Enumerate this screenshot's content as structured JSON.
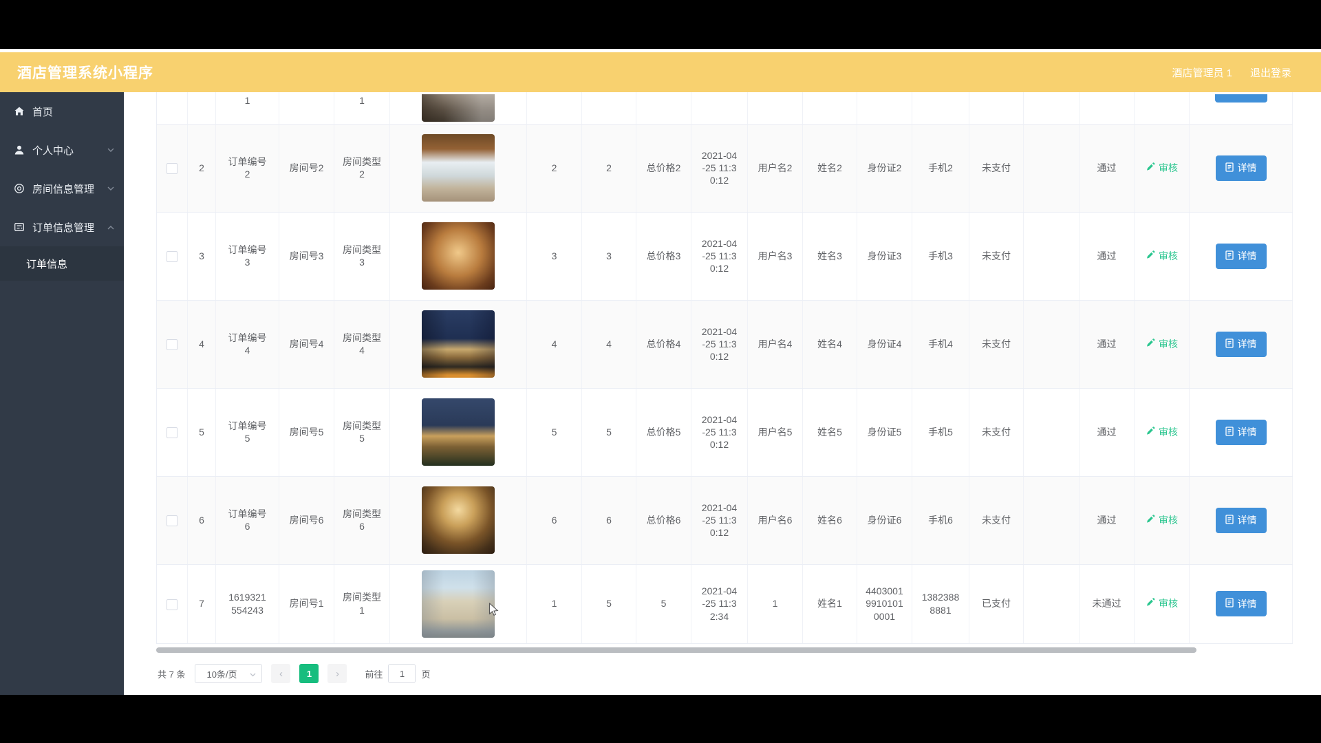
{
  "header": {
    "title": "酒店管理系统小程序",
    "user_label": "酒店管理员 1",
    "logout_label": "退出登录",
    "bg_color": "#F8D16F"
  },
  "sidebar": {
    "bg_color": "#313A47",
    "items": [
      {
        "label": "首页",
        "icon": "home-icon",
        "chevron": ""
      },
      {
        "label": "个人中心",
        "icon": "user-icon",
        "chevron": "down"
      },
      {
        "label": "房间信息管理",
        "icon": "rooms-icon",
        "chevron": "down"
      },
      {
        "label": "订单信息管理",
        "icon": "orders-icon",
        "chevron": "up"
      }
    ],
    "subitem_label": "订单信息"
  },
  "table": {
    "audit_label": "审核",
    "detail_label": "详情",
    "rows": [
      {
        "partial": true,
        "photo": "p1",
        "index": "",
        "order_no": "1",
        "room_no": "",
        "room_type": "1",
        "num1": "",
        "num2": "",
        "total": "",
        "time": "",
        "user": "",
        "name": "",
        "id_card": "",
        "phone": "",
        "pay": "",
        "status": ""
      },
      {
        "photo": "p2",
        "index": "2",
        "order_no": "订单编号2",
        "room_no": "房间号2",
        "room_type": "房间类型2",
        "num1": "2",
        "num2": "2",
        "total": "总价格2",
        "time": "2021-04-25 11:30:12",
        "user": "用户名2",
        "name": "姓名2",
        "id_card": "身份证2",
        "phone": "手机2",
        "pay": "未支付",
        "status": "通过"
      },
      {
        "photo": "p3",
        "index": "3",
        "order_no": "订单编号3",
        "room_no": "房间号3",
        "room_type": "房间类型3",
        "num1": "3",
        "num2": "3",
        "total": "总价格3",
        "time": "2021-04-25 11:30:12",
        "user": "用户名3",
        "name": "姓名3",
        "id_card": "身份证3",
        "phone": "手机3",
        "pay": "未支付",
        "status": "通过"
      },
      {
        "photo": "p4",
        "index": "4",
        "order_no": "订单编号4",
        "room_no": "房间号4",
        "room_type": "房间类型4",
        "num1": "4",
        "num2": "4",
        "total": "总价格4",
        "time": "2021-04-25 11:30:12",
        "user": "用户名4",
        "name": "姓名4",
        "id_card": "身份证4",
        "phone": "手机4",
        "pay": "未支付",
        "status": "通过"
      },
      {
        "photo": "p5",
        "index": "5",
        "order_no": "订单编号5",
        "room_no": "房间号5",
        "room_type": "房间类型5",
        "num1": "5",
        "num2": "5",
        "total": "总价格5",
        "time": "2021-04-25 11:30:12",
        "user": "用户名5",
        "name": "姓名5",
        "id_card": "身份证5",
        "phone": "手机5",
        "pay": "未支付",
        "status": "通过"
      },
      {
        "photo": "p6",
        "index": "6",
        "order_no": "订单编号6",
        "room_no": "房间号6",
        "room_type": "房间类型6",
        "num1": "6",
        "num2": "6",
        "total": "总价格6",
        "time": "2021-04-25 11:30:12",
        "user": "用户名6",
        "name": "姓名6",
        "id_card": "身份证6",
        "phone": "手机6",
        "pay": "未支付",
        "status": "通过"
      },
      {
        "photo": "p7",
        "index": "7",
        "order_no": "1619321554243",
        "room_no": "房间号1",
        "room_type": "房间类型1",
        "num1": "1",
        "num2": "5",
        "total": "5",
        "time": "2021-04-25 11:32:34",
        "user": "1",
        "name": "姓名1",
        "id_card": "440300199101010001",
        "phone": "13823888881",
        "pay": "已支付",
        "status": "未通过"
      }
    ]
  },
  "pagination": {
    "total_text": "共 7 条",
    "page_size": "10条/页",
    "prev": "‹",
    "active_page": "1",
    "next": "›",
    "goto_label": "前往",
    "goto_value": "1",
    "unit_label": "页"
  },
  "colors": {
    "header_bg": "#F8D16F",
    "sidebar_bg": "#313A47",
    "primary_blue": "#4090D9",
    "audit_green": "#2BC68F",
    "pager_green": "#17BD7E",
    "table_border": "#EBEEF5",
    "stripe_bg": "#FAFAFA",
    "text": "#606266",
    "scrollbar": "#A9ACB2"
  },
  "icons": {
    "home-icon": "house",
    "user-icon": "person",
    "rooms-icon": "double-circle",
    "orders-icon": "form-list",
    "chevron-down-icon": "v",
    "chevron-up-icon": "^",
    "edit-pen-icon": "pencil",
    "document-icon": "doc",
    "select-arrow-icon": "v",
    "mouse-cursor": "arrow"
  }
}
